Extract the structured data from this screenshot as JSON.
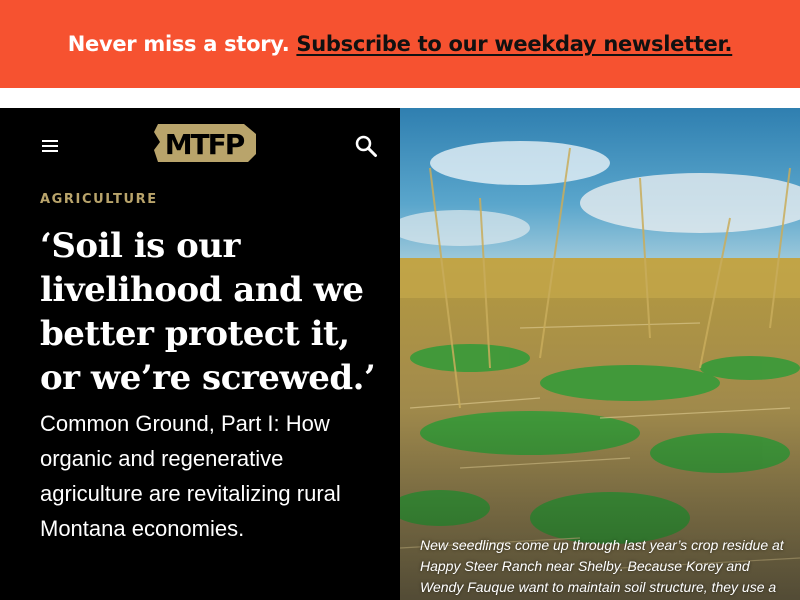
{
  "promo": {
    "text": "Never miss a story.",
    "link_text": "Subscribe to our weekday newsletter.",
    "background": "#f65230"
  },
  "header": {
    "menu_icon": "hamburger-menu-icon",
    "logo_text": "MTFP",
    "logo_color": "#b9a46b",
    "search_icon": "magnifier-search-icon"
  },
  "article": {
    "category": "AGRICULTURE",
    "headline": "‘Soil is our livelihood and we better protect it, or we’re screwed.’",
    "dek": "Common Ground, Part I: How organic and regenerative agriculture are revitalizing rural Montana economies.",
    "caption": "New seedlings come up through last year’s crop residue at Happy Steer Ranch near Shelby. Because Korey and Wendy Fauque want to maintain soil structure, they use a"
  }
}
